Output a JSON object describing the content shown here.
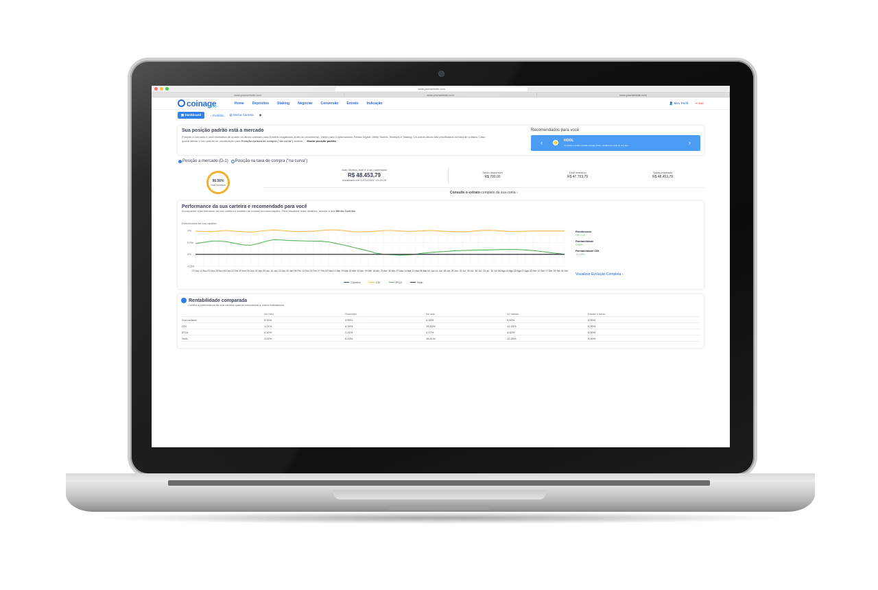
{
  "browser": {
    "url": "www.yourwebsite.com",
    "tabs": [
      "www.yourwebsite.com",
      "www.yourwebsite.com",
      "www.yourwebsite.com"
    ]
  },
  "nav": {
    "logo": "coinage",
    "logo_sub": "GROUP",
    "items": [
      "Home",
      "Depósitos",
      "Staking",
      "Negociar",
      "Conversão",
      "Extrato",
      "Indicação"
    ],
    "profile": "Meu Perfil",
    "logout": "Sair"
  },
  "subnav": {
    "items": [
      "Dashboard",
      "Portfólio",
      "Minha Carteira"
    ]
  },
  "position": {
    "title": "Sua posição padrão está a mercado",
    "text1": "Posição a mercado é uma estimativa de quanto os ativos valeriam caso fossem resgatados antes do vencimento. Válido para Criptomoedas, Renda Digital, Utility Tokens, Startups e Staking. Os outros ativos são precificados na taxa de compra. Caso",
    "text2": "queira alterar o seu padrão de visualização para",
    "text2_bold": "Posição na taxa de compra (\"na curva\")",
    "text2_end": "acesse:",
    "change_link": "Mudar posição padrão"
  },
  "recommended": {
    "title": "Recomendados para você",
    "item_name": "HOOL",
    "item_desc": "Compare o melhor investir a longo prazo, rendimento mais do seu ano."
  },
  "portfolio": {
    "radio_market": "Posição a mercado (D-1)",
    "radio_curve": "Posição na taxa de compra (\"na curva\")",
    "ring_percent": "98.56%",
    "ring_percent_value": 98.56,
    "ring_label": "Total investido",
    "greeting": "Juan Silveira, este é o seu patrimônio",
    "total": "R$ 48.453,79",
    "updated": "Atualizado em 13/11/2023, 15:19:25",
    "stats": [
      {
        "label": "Saldo disponível",
        "value": "R$ 700,00"
      },
      {
        "label": "Total investido",
        "value": "R$ 47.753,79"
      },
      {
        "label": "Saldo projetado",
        "value": "R$ 48.453,79"
      }
    ],
    "statement_bold": "Consulte o extrato",
    "statement_rest": "completo da sua conta"
  },
  "performance": {
    "title": "Performance da sua carteira e recomendado para você",
    "subtitle_a": "Acompanhe a performance da sua carteira e também as nossas recomendações. Para visualizar mais detalhes, acesse a aba",
    "subtitle_b": "Minha Carteira.",
    "chart_title": "Performance da sua carteira",
    "side": [
      {
        "label": "Rendimento",
        "value": "R$ 0,00"
      },
      {
        "label": "Rentabilidade",
        "value": "0,00%"
      },
      {
        "label": "Rentabilidade CDI",
        "value": "12,15%"
      }
    ],
    "full_link": "Visualizar Evolução Completa"
  },
  "chart_data": {
    "type": "line",
    "title": "",
    "xlabel": "",
    "ylabel": "",
    "y_ticks": [
      "1%",
      "0,5%",
      "0%",
      "-0,5%"
    ],
    "ylim": [
      -0.5,
      1
    ],
    "x": [
      "07 Nov",
      "14 Nov",
      "21 Nov",
      "28 Nov",
      "05 Dez",
      "12 Dez",
      "19 Dez",
      "26 Dez",
      "02 Jan",
      "09 Jan",
      "16 Jan",
      "23 Jan",
      "30 Jan",
      "06 Fev",
      "13 Fev",
      "20 Fev",
      "27 Fev",
      "05 Mar",
      "12 Mar",
      "19 Mar",
      "26 Mar",
      "02 Abr",
      "09 Abr",
      "16 Abr",
      "23 Abr",
      "30 Abr",
      "07 Mai",
      "14 Mai",
      "21 Mai",
      "28 Mai",
      "04 Jun",
      "11 Jun",
      "18 Jun",
      "25 Jun",
      "02 Jul",
      "09 Jul",
      "16 Jul",
      "23 Jul",
      "30 Jul",
      "06 Ago",
      "13 Ago",
      "20 Ago",
      "27 Ago",
      "03 Set",
      "10 Set",
      "17 Set",
      "24 Set",
      "01 Out"
    ],
    "series": [
      {
        "name": "Carteira",
        "color": "#2b3a8f",
        "values": [
          0,
          0,
          0,
          0,
          0,
          0,
          0,
          0,
          0,
          0,
          0,
          0,
          0,
          0,
          0,
          0,
          0,
          0,
          0,
          0,
          0,
          0,
          0,
          0,
          0,
          0,
          0,
          0,
          0,
          0,
          0,
          0,
          0,
          0,
          0,
          0,
          0,
          0,
          0,
          0,
          0,
          0,
          0,
          0,
          0,
          0,
          0,
          0
        ]
      },
      {
        "name": "CDI",
        "color": "#f5b83d",
        "values": [
          0.97,
          0.96,
          0.95,
          0.98,
          1.0,
          0.97,
          0.95,
          0.93,
          0.96,
          1.0,
          1.02,
          1.0,
          0.97,
          0.95,
          0.96,
          0.97,
          1.0,
          1.03,
          1.02,
          0.99,
          0.95,
          0.94,
          0.95,
          0.97,
          1.0,
          1.0,
          0.98,
          0.96,
          0.97,
          0.99,
          1.0,
          0.98,
          0.96,
          0.95,
          0.94,
          0.96,
          0.99,
          1.01,
          1.0,
          0.98,
          0.96,
          0.96,
          0.97,
          0.98,
          0.98,
          0.98,
          0.98,
          0.98
        ]
      },
      {
        "name": "IPCA",
        "color": "#4caf50",
        "values": [
          0.45,
          0.5,
          0.55,
          0.56,
          0.53,
          0.46,
          0.4,
          0.38,
          0.45,
          0.55,
          0.62,
          0.6,
          0.58,
          0.57,
          0.56,
          0.55,
          0.55,
          0.52,
          0.45,
          0.38,
          0.3,
          0.22,
          0.14,
          0.05,
          0.0,
          -0.02,
          -0.04,
          -0.03,
          0.0,
          0.05,
          0.08,
          0.1,
          0.12,
          0.15,
          0.16,
          0.17,
          0.18,
          0.18,
          0.19,
          0.2,
          0.2,
          0.2,
          0.18,
          0.16,
          0.12,
          0.08,
          0.04,
          0.0
        ]
      },
      {
        "name": "Selic",
        "color": "#333333",
        "values": [
          0,
          0,
          0,
          0,
          0,
          0,
          0,
          0,
          0,
          0,
          0,
          0,
          0,
          0,
          0,
          0,
          0,
          0,
          0,
          0,
          0,
          0,
          0,
          0,
          0,
          0,
          0,
          0,
          0,
          0,
          0,
          0,
          0,
          0,
          0,
          0,
          0,
          0,
          0,
          0,
          0,
          0,
          0,
          0,
          0,
          0,
          0,
          0
        ]
      }
    ]
  },
  "comparison": {
    "title": "Rentabilidade comparada",
    "subtitle": "Confira a performance da sua carteira quando comparada a outros indicadores.",
    "columns": [
      "",
      "No mês",
      "Semestre",
      "No ano",
      "12 meses",
      "Desde o início"
    ],
    "rows": [
      [
        "Sua carteira",
        "0,00%",
        "0,00%",
        "0,00%",
        "0,00%",
        "0,00%"
      ],
      [
        "CDI",
        "1,01%",
        "6,09%",
        "15,62%",
        "12,15%",
        "0,00%"
      ],
      [
        "IPCA",
        "0,40%",
        "2,41%",
        "4,17%",
        "4,82%",
        "0,00%"
      ],
      [
        "Selic",
        "1,02%",
        "6,13%",
        "15,61%",
        "12,25%",
        "0,00%"
      ]
    ]
  }
}
